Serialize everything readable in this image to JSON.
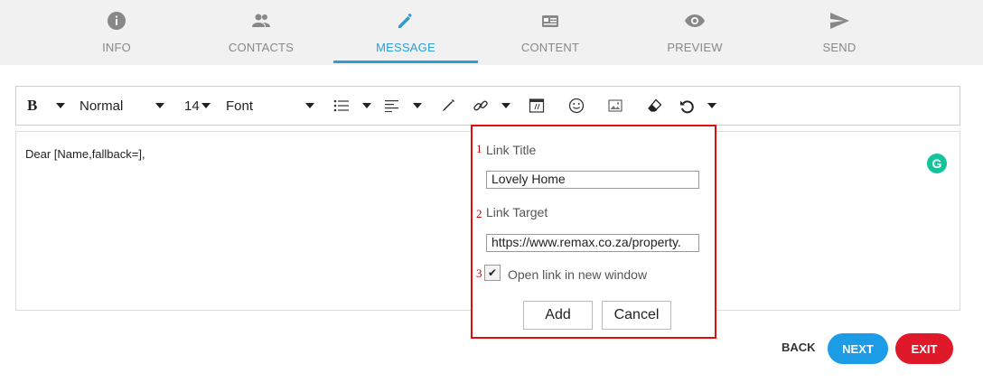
{
  "steps": [
    {
      "label": "INFO",
      "icon": "info-icon"
    },
    {
      "label": "CONTACTS",
      "icon": "contacts-icon"
    },
    {
      "label": "MESSAGE",
      "icon": "pencil-icon",
      "active": true
    },
    {
      "label": "CONTENT",
      "icon": "content-icon"
    },
    {
      "label": "PREVIEW",
      "icon": "eye-icon"
    },
    {
      "label": "SEND",
      "icon": "send-icon"
    }
  ],
  "toolbar": {
    "bold": "B",
    "paragraph_style": "Normal",
    "font_size": "14",
    "font_family": "Font"
  },
  "editor": {
    "content": "Dear [Name,fallback=],"
  },
  "link_dialog": {
    "markers": [
      "1",
      "2",
      "3"
    ],
    "title_label": "Link Title",
    "title_value": "Lovely Home",
    "target_label": "Link Target",
    "target_value": "https://www.remax.co.za/property.",
    "new_window_label": "Open link in new window",
    "new_window_checked": true,
    "add_label": "Add",
    "cancel_label": "Cancel"
  },
  "nav": {
    "back": "BACK",
    "next": "NEXT",
    "exit": "EXIT"
  },
  "colors": {
    "accent": "#2b9ed4",
    "next": "#1c9be6",
    "exit": "#e0192a",
    "highlight": "#e10e0e"
  }
}
